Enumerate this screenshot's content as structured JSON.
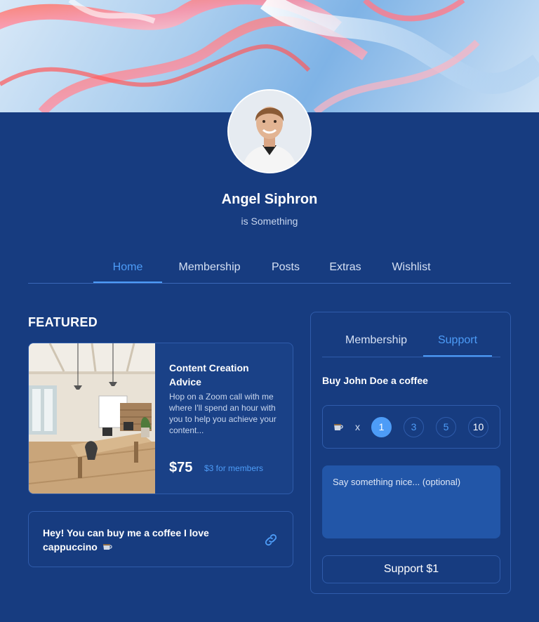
{
  "profile": {
    "name": "Angel Siphron",
    "tagline": "is Something"
  },
  "nav": {
    "items": [
      {
        "label": "Home",
        "active": true
      },
      {
        "label": "Membership",
        "active": false
      },
      {
        "label": "Posts",
        "active": false
      },
      {
        "label": "Extras",
        "active": false
      },
      {
        "label": "Wishlist",
        "active": false
      }
    ]
  },
  "featured": {
    "heading": "FEATURED",
    "card": {
      "title": "Content Creation Advice",
      "description": "Hop on a Zoom call with me where I'll spend an hour with you to help you achieve your content...",
      "price": "$75",
      "member_price": "$3 for members"
    },
    "note": {
      "text": "Hey! You can buy me a coffee I love cappuccino"
    }
  },
  "support_panel": {
    "tabs": [
      {
        "label": "Membership",
        "active": false
      },
      {
        "label": "Support",
        "active": true
      }
    ],
    "title": "Buy John Doe a coffee",
    "multiplier": "x",
    "quantities": [
      "1",
      "3",
      "5",
      "10"
    ],
    "selected_quantity": "1",
    "message_placeholder": "Say something nice... (optional)",
    "button_label": "Support $1"
  },
  "icons": {
    "note_action": "link-icon",
    "coffee": "coffee-cup-icon"
  },
  "colors": {
    "background": "#173c80",
    "accent": "#4d9cf7",
    "border": "#2f5cab",
    "input_bg": "#2256a8"
  }
}
